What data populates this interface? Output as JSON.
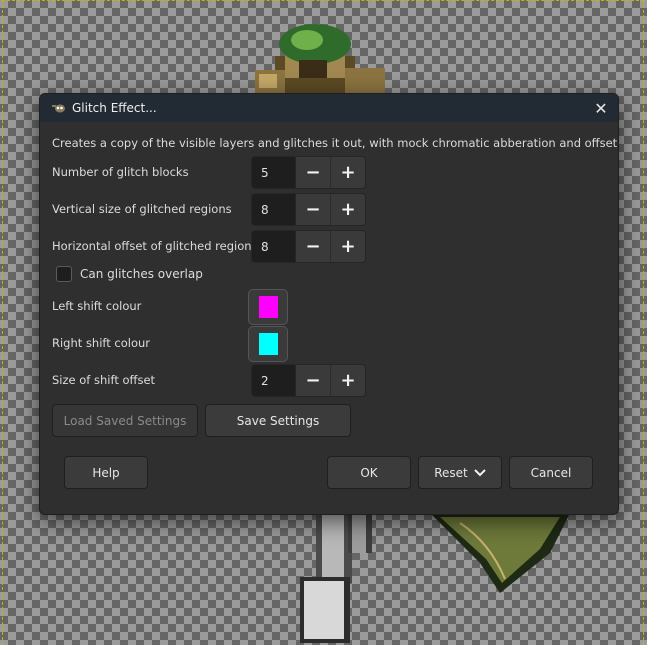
{
  "dialog": {
    "title": "Glitch Effect...",
    "description": "Creates a copy of the visible layers and glitches it out, with mock chromatic abberation and offset chunks."
  },
  "fields": {
    "blocks": {
      "label": "Number of glitch blocks",
      "value": "5"
    },
    "vsize": {
      "label": "Vertical size of glitched regions",
      "value": "8"
    },
    "hoffset": {
      "label": "Horizontal offset of glitched regions",
      "value": "8"
    },
    "overlap": {
      "label": "Can glitches overlap",
      "checked": false
    },
    "left_colour": {
      "label": "Left shift colour",
      "color": "#ff00ff"
    },
    "right_colour": {
      "label": "Right shift colour",
      "color": "#00ffff"
    },
    "shift_offset": {
      "label": "Size of shift offset",
      "value": "2"
    }
  },
  "spin": {
    "minus": "−",
    "plus": "+"
  },
  "buttons": {
    "load": "Load Saved Settings",
    "save": "Save Settings",
    "help": "Help",
    "ok": "OK",
    "reset": "Reset",
    "cancel": "Cancel",
    "close": "✕"
  }
}
